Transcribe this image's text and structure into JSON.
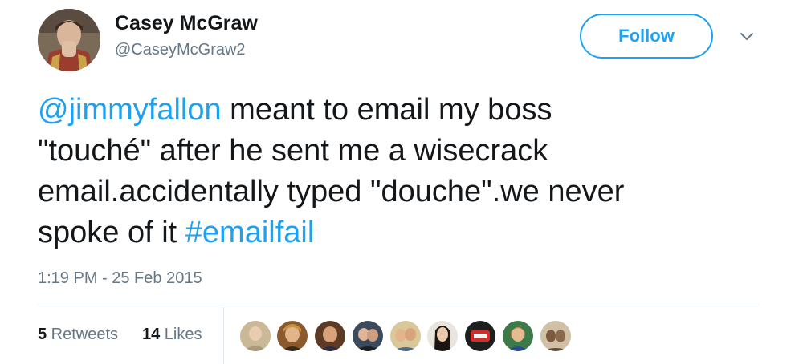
{
  "user": {
    "display_name": "Casey McGraw",
    "handle": "@CaseyMcGraw2"
  },
  "follow_label": "Follow",
  "tweet": {
    "line1_mention": "@jimmyfallon",
    "line1_text": " meant to email my boss",
    "line2": "\"touché\" after he sent me a wisecrack",
    "line3": "email.accidentally typed \"douche\".we never",
    "line4_text": "spoke of it ",
    "line4_hashtag": "#emailfail"
  },
  "timestamp": "1:19 PM - 25 Feb 2015",
  "stats": {
    "retweets_count": "5",
    "retweets_label": " Retweets",
    "likes_count": "14",
    "likes_label": " Likes"
  },
  "colors": {
    "accent": "#1da1f2",
    "text": "#14171a",
    "muted": "#657786",
    "divider": "#e1e8ed"
  },
  "icons": {
    "menu": "chevron-down-icon"
  }
}
